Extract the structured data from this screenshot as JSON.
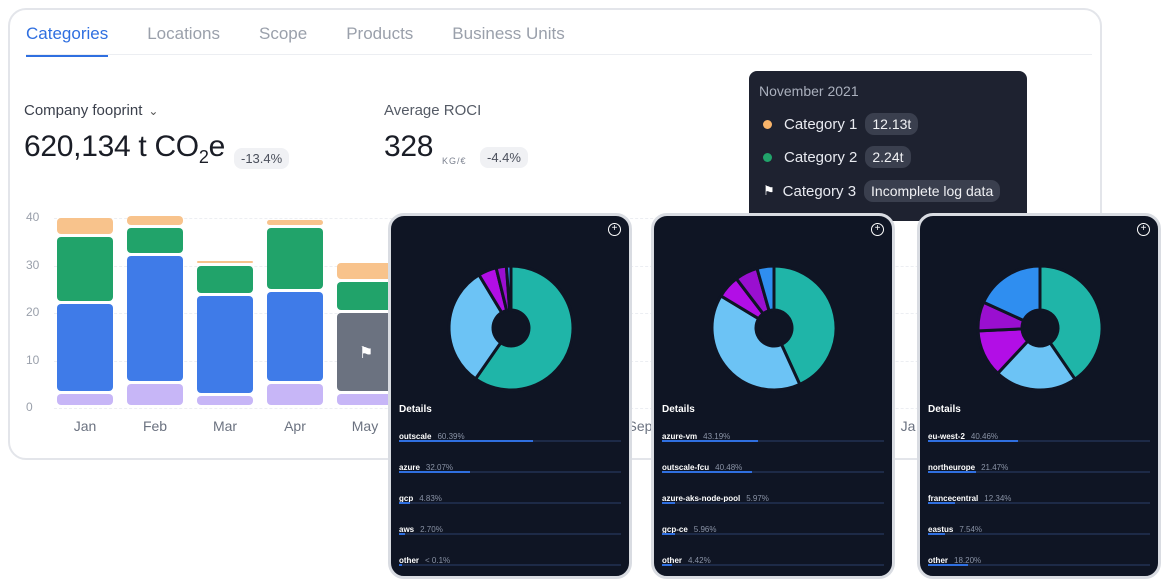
{
  "tabs": [
    "Categories",
    "Locations",
    "Scope",
    "Products",
    "Business Units"
  ],
  "metrics": {
    "footprint": {
      "label": "Company fooprint",
      "value": "620,134 t CO",
      "sub": "2",
      "suffix": "e",
      "change": "-13.4%"
    },
    "roci": {
      "label": "Average ROCI",
      "value": "328",
      "unit": "KG/€",
      "change": "-4.4%"
    }
  },
  "chart_data": {
    "type": "bar",
    "stacked": true,
    "categories": [
      "Jan",
      "Feb",
      "Mar",
      "Apr",
      "May",
      "Sep",
      "Ja"
    ],
    "yticks": [
      "0",
      "10",
      "20",
      "30",
      "40"
    ],
    "ylim": [
      0,
      40
    ],
    "colors": {
      "purple": "#c7b6f7",
      "blue": "#3f7be8",
      "green": "#21a36a",
      "orange": "#f8c38c",
      "gray": "#6b7280"
    },
    "bars": [
      {
        "x": "Jan",
        "segments": [
          3,
          19,
          14,
          4
        ]
      },
      {
        "x": "Feb",
        "segments": [
          5,
          27,
          6,
          2.5
        ]
      },
      {
        "x": "Mar",
        "segments": [
          2.5,
          21,
          6.5,
          1
        ]
      },
      {
        "x": "Apr",
        "segments": [
          5,
          19.5,
          13.5,
          1.5
        ]
      },
      {
        "x": "May",
        "segments": [
          3,
          0,
          6.5,
          4
        ],
        "flag_segment": 17
      }
    ]
  },
  "tooltip": {
    "title": "November 2021",
    "rows": [
      {
        "label": "Category 1",
        "value": "12.13t",
        "color": "#f8b46a",
        "marker": "dot"
      },
      {
        "label": "Category 2",
        "value": "2.24t",
        "color": "#21a36a",
        "marker": "dot"
      },
      {
        "label": "Category 3",
        "value": "Incomplete log data",
        "marker": "flag"
      }
    ]
  },
  "panels": [
    {
      "details_title": "Details",
      "items": [
        {
          "name": "outscale",
          "pct": "60.39%",
          "value": 60.39,
          "color": "#1fb5a8"
        },
        {
          "name": "azure",
          "pct": "32.07%",
          "value": 32.07,
          "color": "#6cc3f5"
        },
        {
          "name": "gcp",
          "pct": "4.83%",
          "value": 4.83,
          "color": "#b20ee6"
        },
        {
          "name": "aws",
          "pct": "2.70%",
          "value": 2.7,
          "color": "#9a0fd0"
        },
        {
          "name": "other",
          "pct": "< 0.1%",
          "value": 0.1,
          "color": "#2f8ef0"
        }
      ]
    },
    {
      "details_title": "Details",
      "items": [
        {
          "name": "azure-vm",
          "pct": "43.19%",
          "value": 43.19,
          "color": "#1fb5a8"
        },
        {
          "name": "outscale-fcu",
          "pct": "40.48%",
          "value": 40.48,
          "color": "#6cc3f5"
        },
        {
          "name": "azure-aks-node-pool",
          "pct": "5.97%",
          "value": 5.97,
          "color": "#b20ee6"
        },
        {
          "name": "gcp-ce",
          "pct": "5.96%",
          "value": 5.96,
          "color": "#9a0fd0"
        },
        {
          "name": "other",
          "pct": "4.42%",
          "value": 4.42,
          "color": "#2f8ef0"
        }
      ]
    },
    {
      "details_title": "Details",
      "items": [
        {
          "name": "eu-west-2",
          "pct": "40.46%",
          "value": 40.46,
          "color": "#1fb5a8"
        },
        {
          "name": "northeurope",
          "pct": "21.47%",
          "value": 21.47,
          "color": "#6cc3f5"
        },
        {
          "name": "francecentral",
          "pct": "12.34%",
          "value": 12.34,
          "color": "#b20ee6"
        },
        {
          "name": "eastus",
          "pct": "7.54%",
          "value": 7.54,
          "color": "#9a0fd0"
        },
        {
          "name": "other",
          "pct": "18.20%",
          "value": 18.2,
          "color": "#2f8ef0"
        }
      ]
    }
  ]
}
